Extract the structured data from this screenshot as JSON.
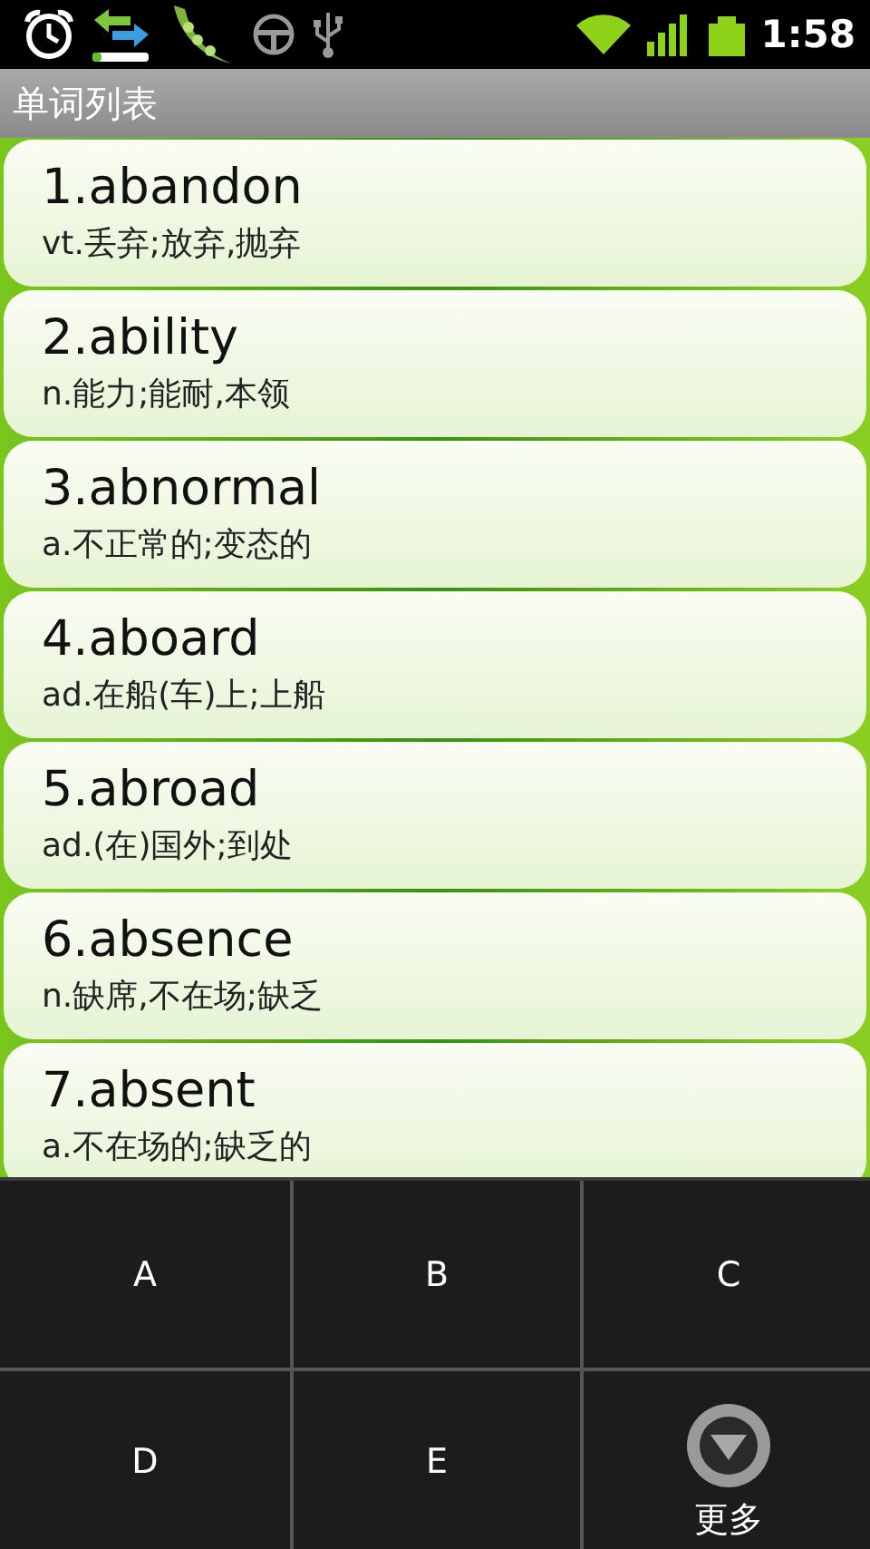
{
  "status_bar": {
    "time": "1:58"
  },
  "title": "单词列表",
  "words": [
    {
      "word": "1.abandon",
      "meaning": "vt.丢弃;放弃,抛弃"
    },
    {
      "word": "2.ability",
      "meaning": "n.能力;能耐,本领"
    },
    {
      "word": "3.abnormal",
      "meaning": "a.不正常的;变态的"
    },
    {
      "word": "4.aboard",
      "meaning": "ad.在船(车)上;上船"
    },
    {
      "word": "5.abroad",
      "meaning": "ad.(在)国外;到处"
    },
    {
      "word": "6.absence",
      "meaning": "n.缺席,不在场;缺乏"
    },
    {
      "word": "7.absent",
      "meaning": "a.不在场的;缺乏的"
    }
  ],
  "menu": {
    "items": [
      {
        "label": "A",
        "kind": "letter"
      },
      {
        "label": "B",
        "kind": "letter"
      },
      {
        "label": "C",
        "kind": "letter"
      },
      {
        "label": "D",
        "kind": "letter"
      },
      {
        "label": "E",
        "kind": "letter"
      },
      {
        "label": "更多",
        "kind": "more"
      }
    ]
  }
}
